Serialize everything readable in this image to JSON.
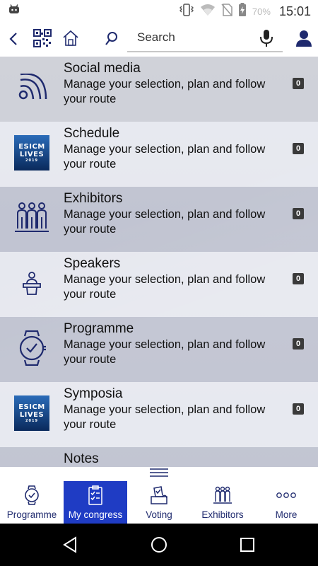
{
  "status_bar": {
    "battery_percent": "70%",
    "time": "15:01"
  },
  "search": {
    "placeholder": "Search"
  },
  "items": [
    {
      "title": "Social media",
      "description": "Manage your selection, plan and follow your route",
      "count": "0",
      "icon": "rss-icon"
    },
    {
      "title": "Schedule",
      "description": "Manage your selection, plan and follow your route",
      "count": "0",
      "icon": "esicm-logo"
    },
    {
      "title": "Exhibitors",
      "description": "Manage your selection, plan and follow your route",
      "count": "0",
      "icon": "people-group-icon"
    },
    {
      "title": "Speakers",
      "description": "Manage your selection, plan and follow your route",
      "count": "0",
      "icon": "speaker-podium-icon"
    },
    {
      "title": "Programme",
      "description": "Manage your selection, plan and follow your route",
      "count": "0",
      "icon": "watch-check-icon"
    },
    {
      "title": "Symposia",
      "description": "Manage your selection, plan and follow your route",
      "count": "0",
      "icon": "esicm-logo"
    },
    {
      "title": "Notes",
      "description": "",
      "count": "",
      "icon": "esicm-logo"
    }
  ],
  "logo": {
    "line1": "ESICM",
    "line2": "LIVES",
    "line3": "2019"
  },
  "tabs": [
    {
      "label": "Programme",
      "icon": "watch-icon",
      "active": false
    },
    {
      "label": "My congress",
      "icon": "checklist-icon",
      "active": true
    },
    {
      "label": "Voting",
      "icon": "ballot-box-icon",
      "active": false
    },
    {
      "label": "Exhibitors",
      "icon": "people-group-icon",
      "active": false
    },
    {
      "label": "More",
      "icon": "more-dots-icon",
      "active": false
    }
  ],
  "colors": {
    "accent": "#1f3cc4",
    "icon_navy": "#1f2a6e"
  }
}
